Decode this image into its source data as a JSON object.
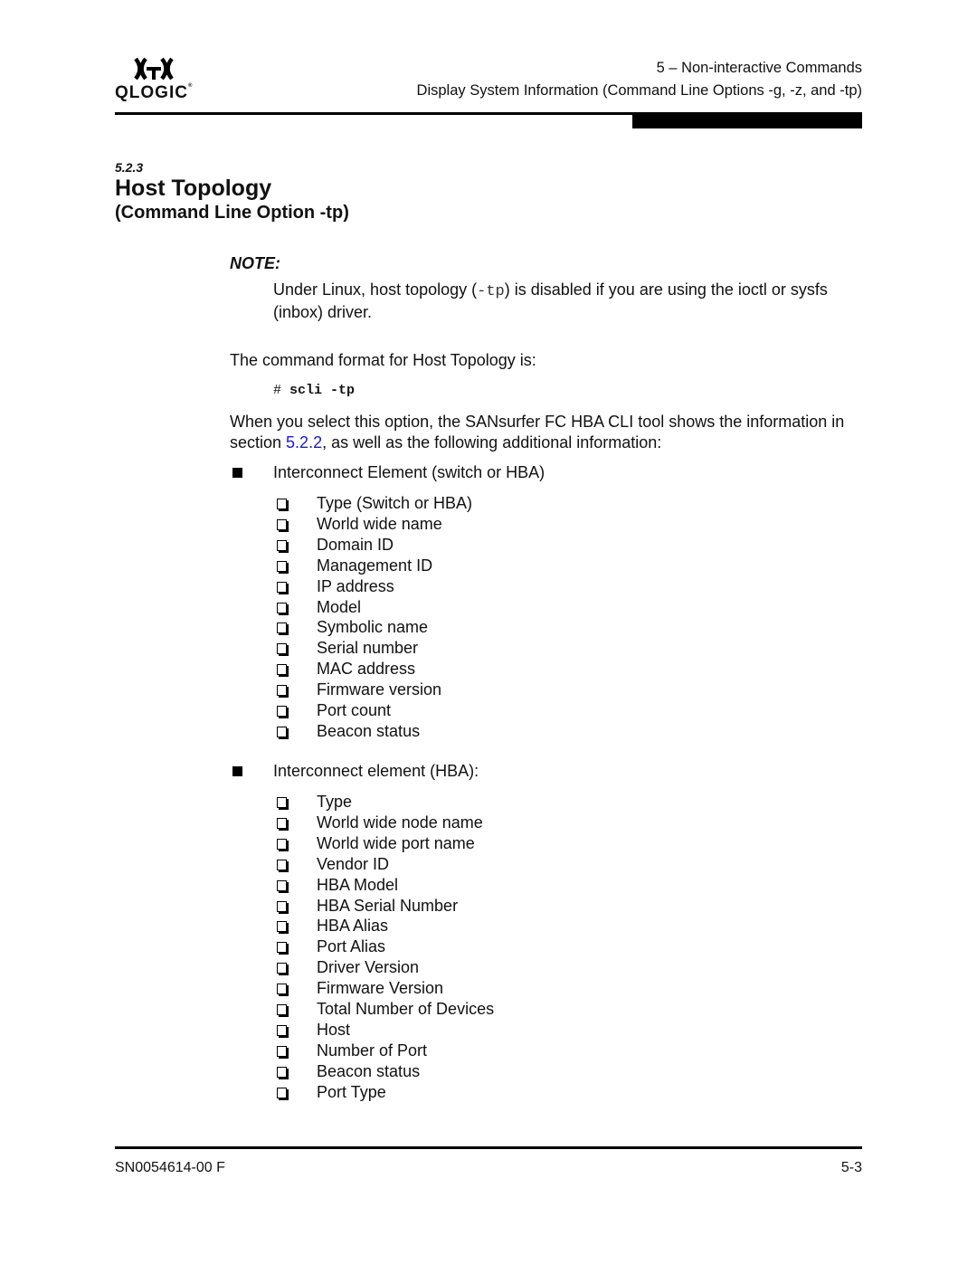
{
  "header": {
    "logo_text": "QLOGIC",
    "logo_mark": "registered",
    "chapter": "5 – Non-interactive Commands",
    "section": "Display System Information  (Command Line Options -g, -z, and -tp)"
  },
  "heading": {
    "number": "5.2.3",
    "title": "Host Topology",
    "subtitle": "(Command Line Option -tp)"
  },
  "note": {
    "label": "NOTE:",
    "text_before": "Under Linux, host topology (",
    "code": "-tp",
    "text_after": ") is disabled if you are using the ioctl or sysfs (inbox) driver."
  },
  "body": {
    "format_intro": "The command format for Host Topology is:",
    "command_prompt": "#",
    "command": "scli -tp",
    "desc_before": "When you select this option, the SANsurfer FC HBA CLI tool shows the information in section ",
    "desc_link": "5.2.2",
    "desc_after": ", as well as the following additional information:"
  },
  "lists": [
    {
      "label": "Interconnect Element (switch or HBA)",
      "items": [
        "Type (Switch or HBA)",
        "World wide name",
        "Domain ID",
        "Management ID",
        "IP address",
        "Model",
        "Symbolic name",
        "Serial number",
        "MAC address",
        "Firmware version",
        "Port count",
        "Beacon status"
      ]
    },
    {
      "label": "Interconnect element (HBA):",
      "items": [
        "Type",
        "World wide node name",
        "World wide port name",
        "Vendor ID",
        "HBA Model",
        "HBA Serial Number",
        "HBA Alias",
        "Port Alias",
        "Driver Version",
        "Firmware Version",
        "Total Number of Devices",
        "Host",
        "Number of Port",
        "Beacon status",
        "Port Type"
      ]
    }
  ],
  "footer": {
    "doc_id": "SN0054614-00  F",
    "page": "5-3"
  }
}
